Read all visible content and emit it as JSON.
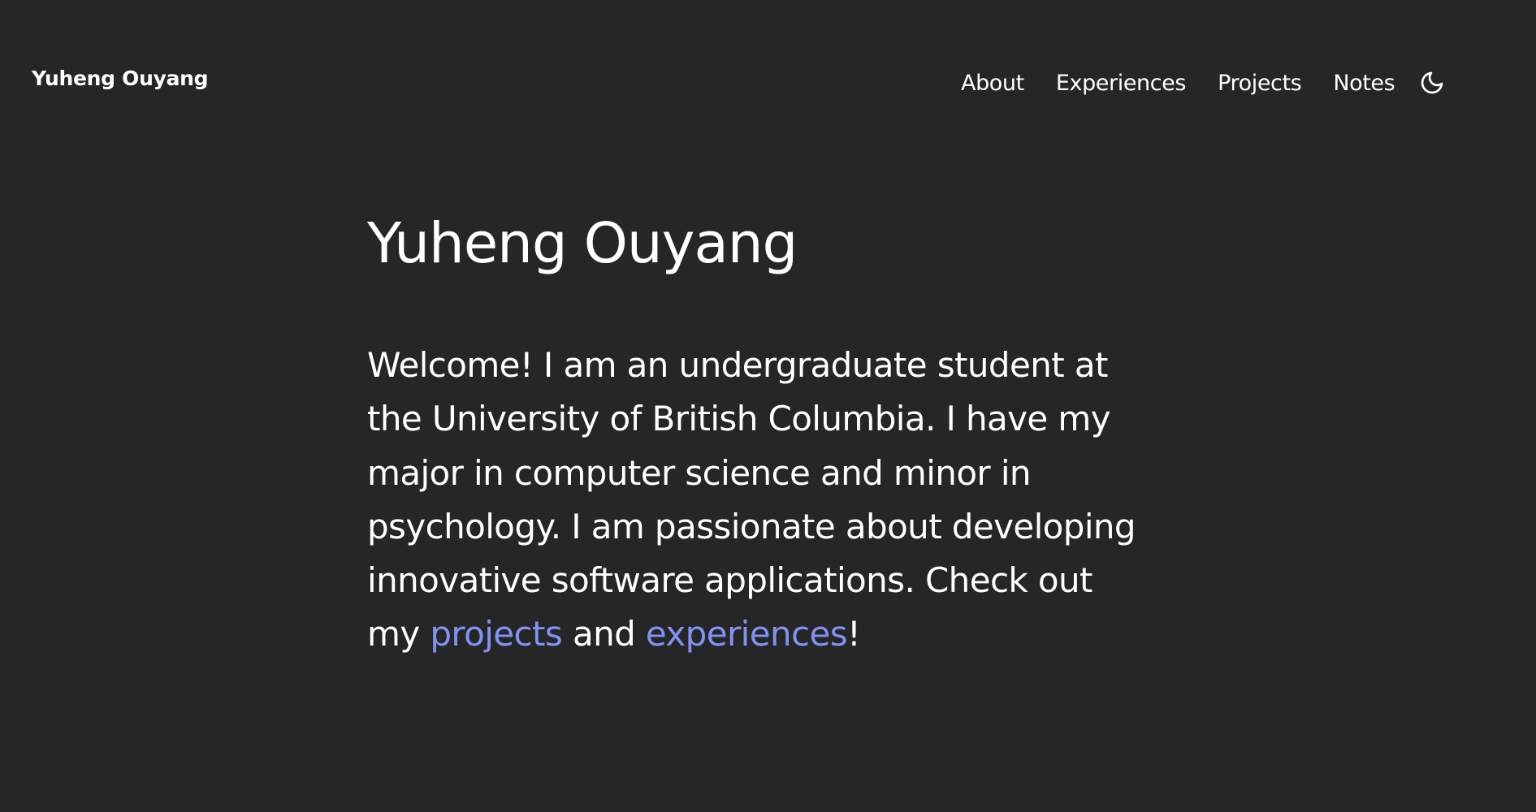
{
  "header": {
    "brand": "Yuheng Ouyang",
    "nav": [
      {
        "label": "About"
      },
      {
        "label": "Experiences"
      },
      {
        "label": "Projects"
      },
      {
        "label": "Notes"
      }
    ],
    "theme_toggle_icon": "moon-icon"
  },
  "main": {
    "title": "Yuheng Ouyang",
    "intro": {
      "line1": "Welcome! I am an undergraduate student at",
      "line2": "the University of British Columbia. I have my",
      "line3": "major in computer science and minor in",
      "line4": "psychology. I am passionate about developing",
      "line5": "innovative software applications. Check out",
      "line6_start": "my ",
      "projects_link": "projects",
      "and_text": " and ",
      "experiences_link": "experiences",
      "end_text": "!"
    }
  },
  "colors": {
    "background": "#262626",
    "text": "#ffffff",
    "link": "#8193f2"
  }
}
